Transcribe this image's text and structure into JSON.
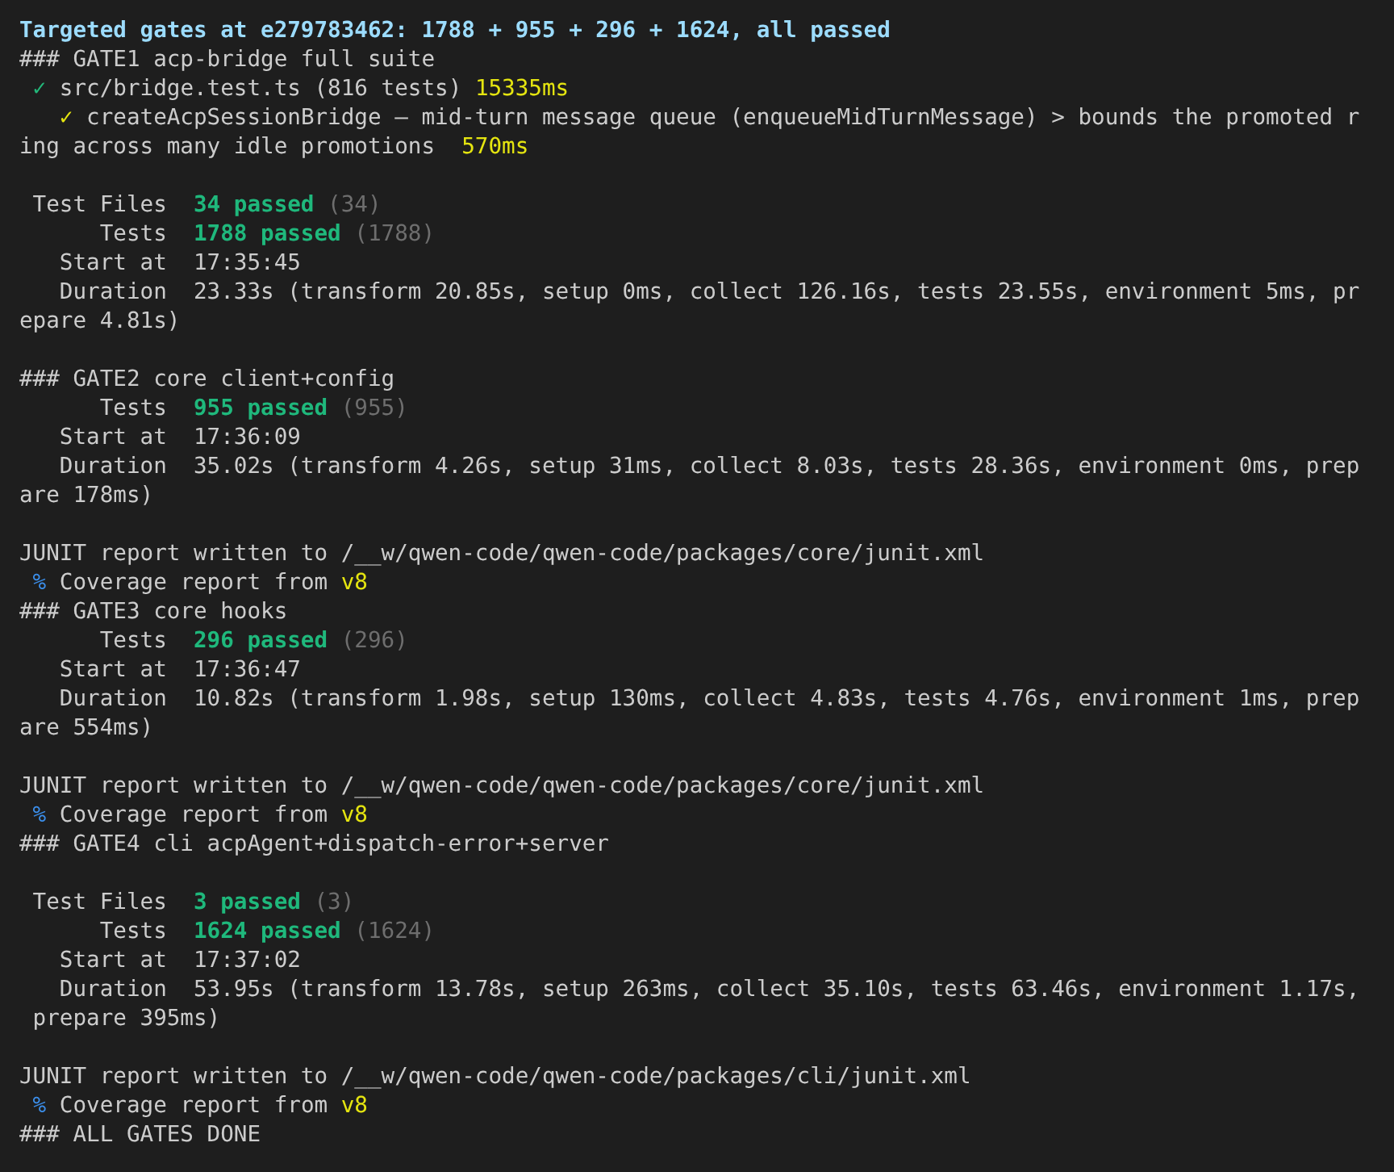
{
  "terminal": {
    "blocks": [
      [
        {
          "segments": [
            {
              "kind": "heading",
              "text": "Targeted gates at e279783462: 1788 + 955 + 296 + 1624, all passed"
            }
          ]
        },
        {
          "segments": [
            {
              "kind": "plain",
              "text": "### GATE1 acp-bridge full suite"
            }
          ]
        },
        {
          "segments": [
            {
              "kind": "check",
              "text": " ✓"
            },
            {
              "kind": "plain",
              "text": " src/bridge.test.ts (816 tests) "
            },
            {
              "kind": "time",
              "text": "15335ms"
            }
          ]
        },
        {
          "segments": [
            {
              "kind": "slow-check",
              "text": "   ✓"
            },
            {
              "kind": "plain",
              "text": " createAcpSessionBridge – mid-turn message queue (enqueueMidTurnMessage) > bounds the promoted r"
            }
          ]
        },
        {
          "segments": [
            {
              "kind": "plain",
              "text": "ing across many idle promotions  "
            },
            {
              "kind": "time",
              "text": "570ms"
            }
          ]
        }
      ],
      [
        {
          "segments": [
            {
              "kind": "plain",
              "text": " Test Files  "
            },
            {
              "kind": "pass",
              "text": "34 passed"
            },
            {
              "kind": "dim",
              "text": " (34)"
            }
          ]
        },
        {
          "segments": [
            {
              "kind": "plain",
              "text": "      Tests  "
            },
            {
              "kind": "pass",
              "text": "1788 passed"
            },
            {
              "kind": "dim",
              "text": " (1788)"
            }
          ]
        },
        {
          "segments": [
            {
              "kind": "plain",
              "text": "   Start at  17:35:45"
            }
          ]
        },
        {
          "segments": [
            {
              "kind": "plain",
              "text": "   Duration  23.33s (transform 20.85s, setup 0ms, collect 126.16s, tests 23.55s, environment 5ms, pr"
            }
          ]
        },
        {
          "segments": [
            {
              "kind": "plain",
              "text": "epare 4.81s)"
            }
          ]
        }
      ],
      [
        {
          "segments": [
            {
              "kind": "plain",
              "text": "### GATE2 core client+config"
            }
          ]
        },
        {
          "segments": [
            {
              "kind": "plain",
              "text": "      Tests  "
            },
            {
              "kind": "pass",
              "text": "955 passed"
            },
            {
              "kind": "dim",
              "text": " (955)"
            }
          ]
        },
        {
          "segments": [
            {
              "kind": "plain",
              "text": "   Start at  17:36:09"
            }
          ]
        },
        {
          "segments": [
            {
              "kind": "plain",
              "text": "   Duration  35.02s (transform 4.26s, setup 31ms, collect 8.03s, tests 28.36s, environment 0ms, prep"
            }
          ]
        },
        {
          "segments": [
            {
              "kind": "plain",
              "text": "are 178ms)"
            }
          ]
        }
      ],
      [
        {
          "segments": [
            {
              "kind": "plain",
              "text": "JUNIT report written to /__w/qwen-code/qwen-code/packages/core/junit.xml"
            }
          ]
        },
        {
          "segments": [
            {
              "kind": "percent",
              "text": " %"
            },
            {
              "kind": "plain",
              "text": " Coverage report from "
            },
            {
              "kind": "time",
              "text": "v8"
            }
          ]
        },
        {
          "segments": [
            {
              "kind": "plain",
              "text": "### GATE3 core hooks"
            }
          ]
        },
        {
          "segments": [
            {
              "kind": "plain",
              "text": "      Tests  "
            },
            {
              "kind": "pass",
              "text": "296 passed"
            },
            {
              "kind": "dim",
              "text": " (296)"
            }
          ]
        },
        {
          "segments": [
            {
              "kind": "plain",
              "text": "   Start at  17:36:47"
            }
          ]
        },
        {
          "segments": [
            {
              "kind": "plain",
              "text": "   Duration  10.82s (transform 1.98s, setup 130ms, collect 4.83s, tests 4.76s, environment 1ms, prep"
            }
          ]
        },
        {
          "segments": [
            {
              "kind": "plain",
              "text": "are 554ms)"
            }
          ]
        }
      ],
      [
        {
          "segments": [
            {
              "kind": "plain",
              "text": "JUNIT report written to /__w/qwen-code/qwen-code/packages/core/junit.xml"
            }
          ]
        },
        {
          "segments": [
            {
              "kind": "percent",
              "text": " %"
            },
            {
              "kind": "plain",
              "text": " Coverage report from "
            },
            {
              "kind": "time",
              "text": "v8"
            }
          ]
        },
        {
          "segments": [
            {
              "kind": "plain",
              "text": "### GATE4 cli acpAgent+dispatch-error+server"
            }
          ]
        }
      ],
      [
        {
          "segments": [
            {
              "kind": "plain",
              "text": " Test Files  "
            },
            {
              "kind": "pass",
              "text": "3 passed"
            },
            {
              "kind": "dim",
              "text": " (3)"
            }
          ]
        },
        {
          "segments": [
            {
              "kind": "plain",
              "text": "      Tests  "
            },
            {
              "kind": "pass",
              "text": "1624 passed"
            },
            {
              "kind": "dim",
              "text": " (1624)"
            }
          ]
        },
        {
          "segments": [
            {
              "kind": "plain",
              "text": "   Start at  17:37:02"
            }
          ]
        },
        {
          "segments": [
            {
              "kind": "plain",
              "text": "   Duration  53.95s (transform 13.78s, setup 263ms, collect 35.10s, tests 63.46s, environment 1.17s,"
            }
          ]
        },
        {
          "segments": [
            {
              "kind": "plain",
              "text": " prepare 395ms)"
            }
          ]
        }
      ],
      [
        {
          "segments": [
            {
              "kind": "plain",
              "text": "JUNIT report written to /__w/qwen-code/qwen-code/packages/cli/junit.xml"
            }
          ]
        },
        {
          "segments": [
            {
              "kind": "percent",
              "text": " %"
            },
            {
              "kind": "plain",
              "text": " Coverage report from "
            },
            {
              "kind": "time",
              "text": "v8"
            }
          ]
        },
        {
          "segments": [
            {
              "kind": "plain",
              "text": "### ALL GATES DONE"
            }
          ]
        }
      ]
    ]
  }
}
